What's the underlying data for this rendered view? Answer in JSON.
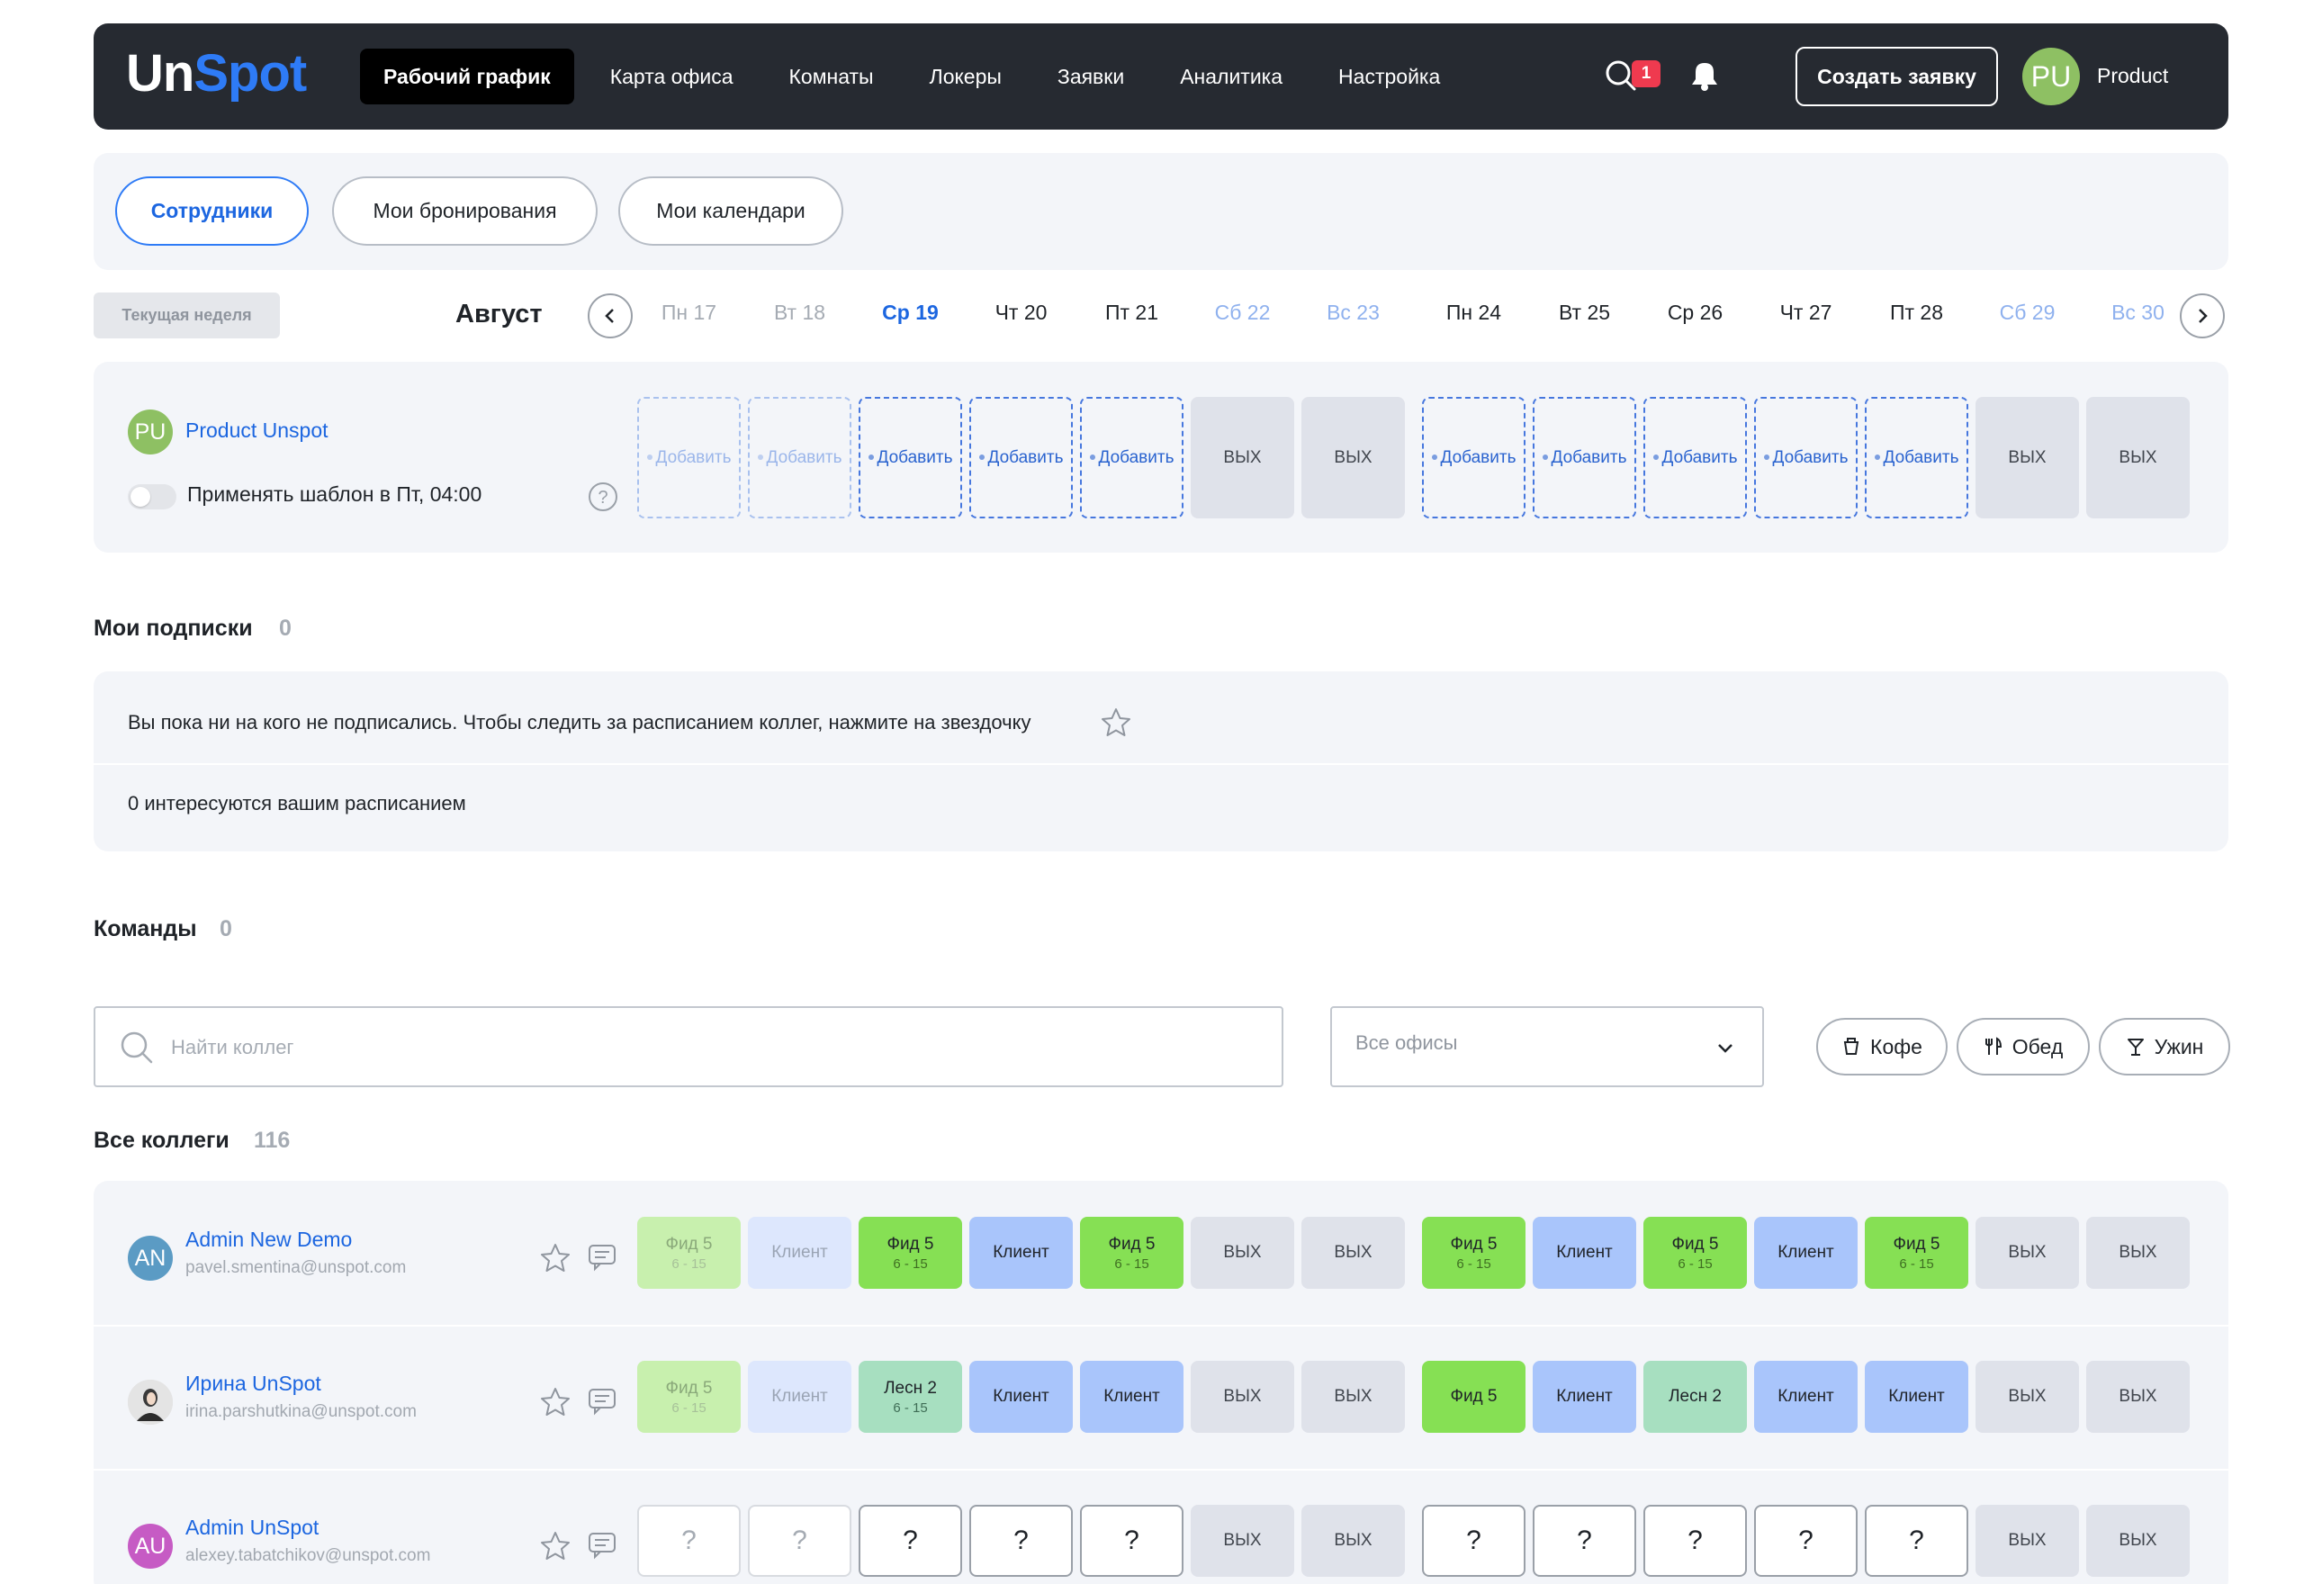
{
  "header": {
    "logo_part1": "Un",
    "logo_part2": "Spot",
    "nav": [
      "Рабочий график",
      "Карта офиса",
      "Комнаты",
      "Локеры",
      "Заявки",
      "Аналитика",
      "Настройка"
    ],
    "notifications_count": "1",
    "create_button": "Создать заявку",
    "user_initials": "PU",
    "user_name": "Product"
  },
  "subtabs": [
    "Сотрудники",
    "Мои бронирования",
    "Мои календари"
  ],
  "week": {
    "current_week_button": "Текущая неделя",
    "month": "Август",
    "days": [
      "Пн 17",
      "Вт 18",
      "Ср 19",
      "Чт 20",
      "Пт 21",
      "Сб 22",
      "Вс 23",
      "Пн 24",
      "Вт 25",
      "Ср 26",
      "Чт 27",
      "Пт 28",
      "Сб 29",
      "Вс 30"
    ]
  },
  "me": {
    "initials": "PU",
    "name": "Product Unspot",
    "template_label": "Применять шаблон в Пт, 04:00",
    "add_label": "Добавить",
    "off_label": "ВЫХ"
  },
  "subscriptions": {
    "title": "Мои подписки",
    "count": "0",
    "empty_text": "Вы пока ни на кого не подписались. Чтобы следить за расписанием коллег, нажмите на звездочку",
    "interest_text": "0 интересуются вашим расписанием"
  },
  "teams": {
    "title": "Команды",
    "count": "0"
  },
  "filters": {
    "search_placeholder": "Найти коллег",
    "office_select": "Все офисы",
    "pills": [
      "Кофе",
      "Обед",
      "Ужин"
    ]
  },
  "colleagues": {
    "title": "Все коллеги",
    "count": "116",
    "people": [
      {
        "initials": "AN",
        "name": "Admin New Demo",
        "email": "pavel.smentina@unspot.com",
        "avatar_color": "#5b9bc4",
        "cells": [
          {
            "label": "Фид 5",
            "sub": "6 - 15"
          },
          {
            "label": "Клиент",
            "sub": ""
          },
          {
            "label": "Фид 5",
            "sub": "6 - 15"
          },
          {
            "label": "Клиент",
            "sub": ""
          },
          {
            "label": "Фид 5",
            "sub": "6 - 15"
          },
          {
            "label": "ВЫХ",
            "sub": ""
          },
          {
            "label": "ВЫХ",
            "sub": ""
          },
          {
            "label": "Фид 5",
            "sub": "6 - 15"
          },
          {
            "label": "Клиент",
            "sub": ""
          },
          {
            "label": "Фид 5",
            "sub": "6 - 15"
          },
          {
            "label": "Клиент",
            "sub": ""
          },
          {
            "label": "Фид 5",
            "sub": "6 - 15"
          },
          {
            "label": "ВЫХ",
            "sub": ""
          },
          {
            "label": "ВЫХ",
            "sub": ""
          }
        ]
      },
      {
        "initials": "",
        "name": "Ирина UnSpot",
        "email": "irina.parshutkina@unspot.com",
        "avatar_color": "#d9d9d9",
        "cells": [
          {
            "label": "Фид 5",
            "sub": "6 - 15"
          },
          {
            "label": "Клиент",
            "sub": ""
          },
          {
            "label": "Лесн 2",
            "sub": "6 - 15"
          },
          {
            "label": "Клиент",
            "sub": ""
          },
          {
            "label": "Клиент",
            "sub": ""
          },
          {
            "label": "ВЫХ",
            "sub": ""
          },
          {
            "label": "ВЫХ",
            "sub": ""
          },
          {
            "label": "Фид 5",
            "sub": ""
          },
          {
            "label": "Клиент",
            "sub": ""
          },
          {
            "label": "Лесн 2",
            "sub": ""
          },
          {
            "label": "Клиент",
            "sub": ""
          },
          {
            "label": "Клиент",
            "sub": ""
          },
          {
            "label": "ВЫХ",
            "sub": ""
          },
          {
            "label": "ВЫХ",
            "sub": ""
          }
        ]
      },
      {
        "initials": "AU",
        "name": "Admin UnSpot",
        "email": "alexey.tabatchikov@unspot.com",
        "avatar_color": "#c65bc4",
        "cells": [
          {
            "label": "?",
            "sub": ""
          },
          {
            "label": "?",
            "sub": ""
          },
          {
            "label": "?",
            "sub": ""
          },
          {
            "label": "?",
            "sub": ""
          },
          {
            "label": "?",
            "sub": ""
          },
          {
            "label": "ВЫХ",
            "sub": ""
          },
          {
            "label": "ВЫХ",
            "sub": ""
          },
          {
            "label": "?",
            "sub": ""
          },
          {
            "label": "?",
            "sub": ""
          },
          {
            "label": "?",
            "sub": ""
          },
          {
            "label": "?",
            "sub": ""
          },
          {
            "label": "?",
            "sub": ""
          },
          {
            "label": "ВЫХ",
            "sub": ""
          },
          {
            "label": "ВЫХ",
            "sub": ""
          }
        ]
      }
    ]
  },
  "colors": {
    "accent": "#2e7bf6",
    "header_bg": "#262a31",
    "fid": "#86e054",
    "client": "#a9c5fb",
    "lesn": "#a7dfc0",
    "off": "#dfe2ea",
    "badge": "#ef3a4f"
  }
}
